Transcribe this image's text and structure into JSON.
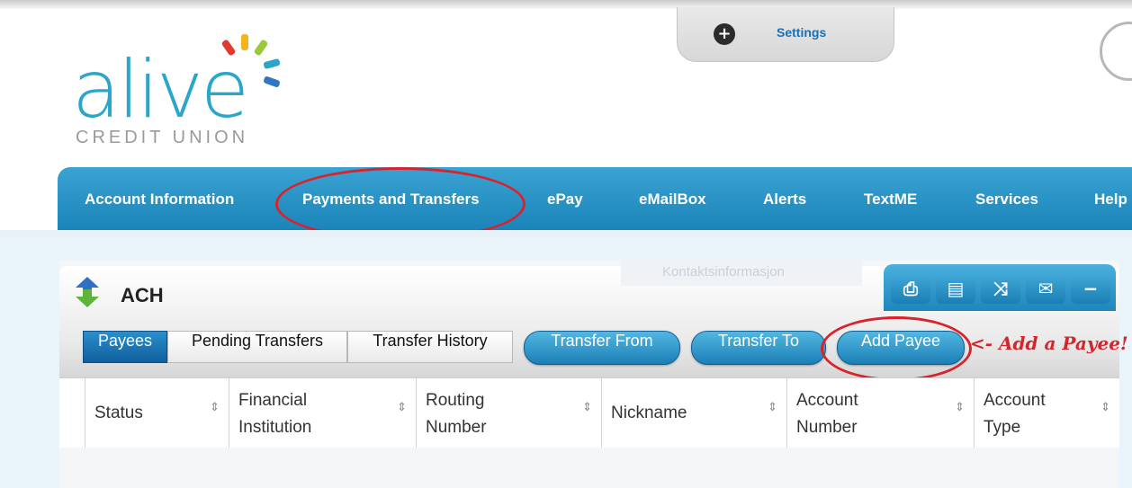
{
  "settings": {
    "plus_glyph": "+",
    "label": "Settings"
  },
  "logo": {
    "word": "alive",
    "sub": "CREDIT UNION",
    "ray_colors": [
      "#e23a2e",
      "#f4b41a",
      "#9bc93a",
      "#29a6c9",
      "#2f77c0"
    ]
  },
  "nav": {
    "items": [
      {
        "label": "Account Information"
      },
      {
        "label": "Payments and Transfers"
      },
      {
        "label": "ePay"
      },
      {
        "label": "eMailBox"
      },
      {
        "label": "Alerts"
      },
      {
        "label": "TextME"
      },
      {
        "label": "Services"
      },
      {
        "label": "Help"
      }
    ]
  },
  "panel": {
    "title": "ACH",
    "ghost_text": "Kontaktsinformasjon"
  },
  "tools": [
    "printer-icon",
    "calculator-icon",
    "shuffle-icon",
    "envelope-add-icon",
    "minus-icon"
  ],
  "subtabs": [
    {
      "label": "Payees",
      "active": true
    },
    {
      "label": "Pending Transfers"
    },
    {
      "label": "Transfer History"
    }
  ],
  "actions": {
    "transfer_from": "Transfer From",
    "transfer_to": "Transfer To",
    "add_payee": "Add Payee"
  },
  "annotation": "<- Add a Payee!",
  "table": {
    "columns": [
      {
        "line1": "Status",
        "line2": ""
      },
      {
        "line1": "Financial",
        "line2": "Institution"
      },
      {
        "line1": "Routing",
        "line2": "Number"
      },
      {
        "line1": "Nickname",
        "line2": ""
      },
      {
        "line1": "Account",
        "line2": "Number"
      },
      {
        "line1": "Account",
        "line2": "Type"
      }
    ],
    "sort_glyph": "⇕"
  },
  "colors": {
    "accent": "#1b84b9",
    "annotation": "#d9232c",
    "logo_blue": "#29a6c9"
  }
}
